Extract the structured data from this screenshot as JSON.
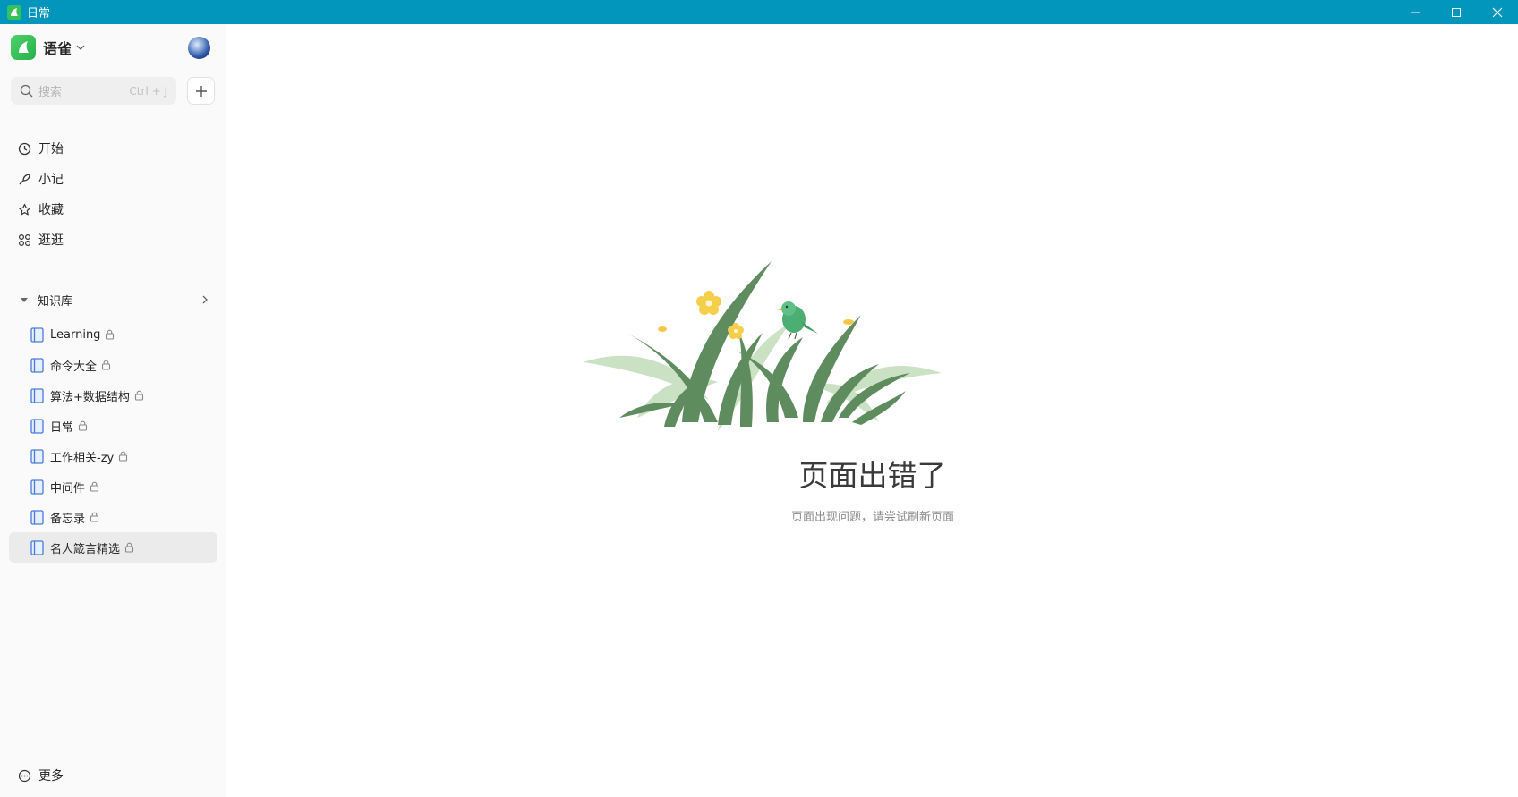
{
  "window": {
    "title": "日常",
    "controls": [
      "minimize-icon",
      "maximize-icon",
      "close-icon"
    ],
    "titlebar_color": "#0396bd"
  },
  "sidebar": {
    "brand": "语雀",
    "search": {
      "placeholder": "搜索",
      "shortcut": "Ctrl + J"
    },
    "nav": [
      {
        "label": "开始",
        "icon": "clock-icon"
      },
      {
        "label": "小记",
        "icon": "feather-icon"
      },
      {
        "label": "收藏",
        "icon": "star-icon"
      },
      {
        "label": "逛逛",
        "icon": "grid-icon"
      }
    ],
    "knowledge_base": {
      "header": "知识库",
      "items": [
        {
          "label": "Learning"
        },
        {
          "label": "命令大全"
        },
        {
          "label": "算法+数据结构"
        },
        {
          "label": "日常"
        },
        {
          "label": "工作相关-zy"
        },
        {
          "label": "中间件"
        },
        {
          "label": "备忘录"
        },
        {
          "label": "名人箴言精选",
          "active": true
        }
      ]
    },
    "more": "更多"
  },
  "main": {
    "error_title": "页面出错了",
    "error_desc": "页面出现问题，请尝试刷新页面"
  }
}
